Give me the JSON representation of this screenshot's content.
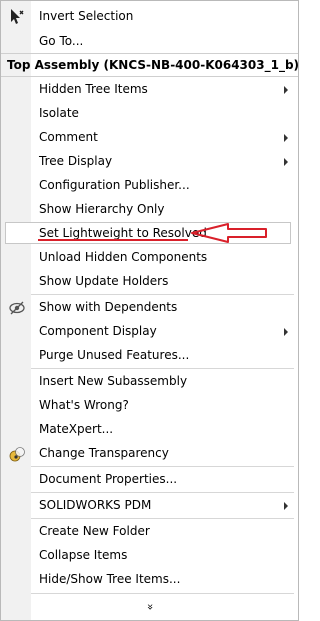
{
  "menu": {
    "items": [
      {
        "label": "Invert Selection"
      },
      {
        "label": "Go To..."
      },
      {
        "label": "Hidden Tree Items"
      },
      {
        "label": "Isolate"
      },
      {
        "label": "Comment"
      },
      {
        "label": "Tree Display"
      },
      {
        "label": "Configuration Publisher..."
      },
      {
        "label": "Show Hierarchy Only"
      },
      {
        "label": "Set Lightweight to Resolved"
      },
      {
        "label": "Unload Hidden Components"
      },
      {
        "label": "Show Update Holders"
      },
      {
        "label": "Show with Dependents"
      },
      {
        "label": "Component Display"
      },
      {
        "label": "Purge Unused Features..."
      },
      {
        "label": "Insert New Subassembly"
      },
      {
        "label": "What's Wrong?"
      },
      {
        "label": "MateXpert..."
      },
      {
        "label": "Change Transparency"
      },
      {
        "label": "Document Properties..."
      },
      {
        "label": "SOLIDWORKS PDM"
      },
      {
        "label": "Create New Folder"
      },
      {
        "label": "Collapse Items"
      },
      {
        "label": "Hide/Show Tree Items..."
      }
    ],
    "header": "Top Assembly (KNCS-NB-400-K064303_1_b)",
    "expand_glyph": "»"
  },
  "icons": {
    "invert_selection": "cursor-icon",
    "show_with_dependents": "eye-icon",
    "change_transparency": "transparency-icon"
  },
  "annotation": {
    "color": "#d9202a"
  }
}
